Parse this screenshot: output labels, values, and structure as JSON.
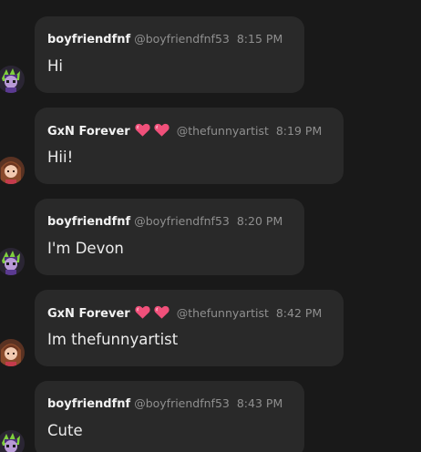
{
  "messages": [
    {
      "author": "boyfriendfnf",
      "handle": "@boyfriendfnf53",
      "time": "8:15 PM",
      "text": "Hi",
      "avatar": "boyfriend-avatar",
      "badges": []
    },
    {
      "author": "GxN Forever",
      "handle": "@thefunnyartist",
      "time": "8:19 PM",
      "text": "Hii!",
      "avatar": "gxn-avatar",
      "badges": [
        "heart-icon",
        "heart-icon"
      ]
    },
    {
      "author": "boyfriendfnf",
      "handle": "@boyfriendfnf53",
      "time": "8:20 PM",
      "text": "I'm Devon",
      "avatar": "boyfriend-avatar",
      "badges": []
    },
    {
      "author": "GxN Forever",
      "handle": "@thefunnyartist",
      "time": "8:42 PM",
      "text": "Im thefunnyartist",
      "avatar": "gxn-avatar",
      "badges": [
        "heart-icon",
        "heart-icon"
      ]
    },
    {
      "author": "boyfriendfnf",
      "handle": "@boyfriendfnf53",
      "time": "8:43 PM",
      "text": "Cute",
      "avatar": "boyfriend-avatar",
      "badges": []
    }
  ],
  "colors": {
    "background": "#191919",
    "bubble": "#292929",
    "heart": "#f0507a",
    "meta_text": "#8f8f8f"
  }
}
